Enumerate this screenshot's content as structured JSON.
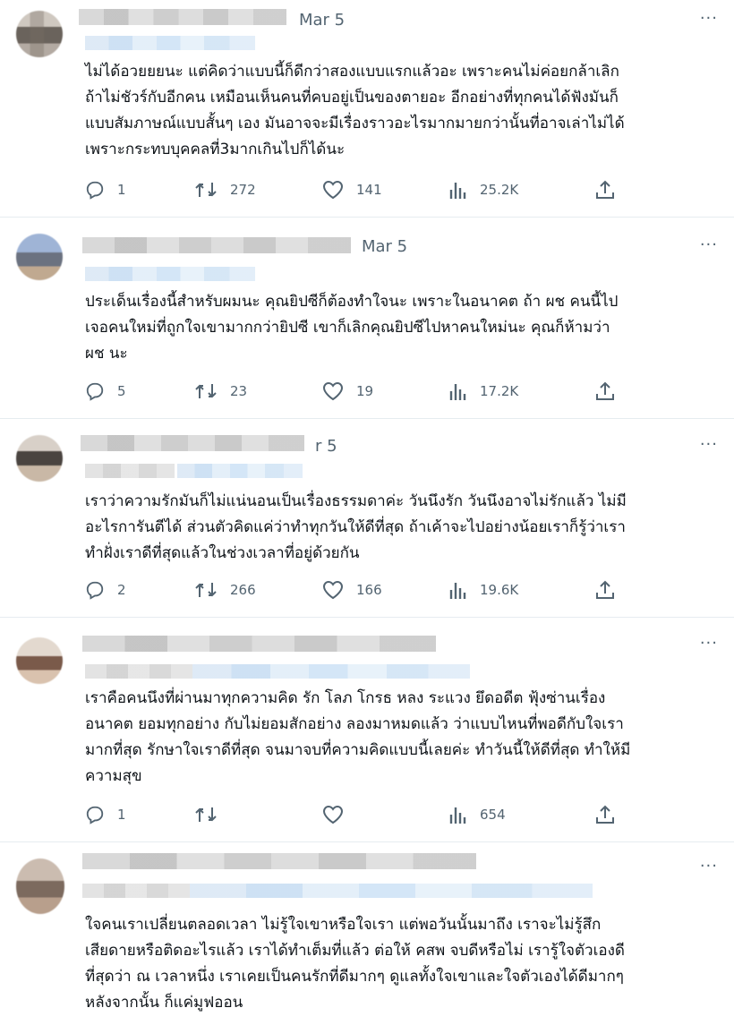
{
  "icons": {
    "reply": "reply-icon",
    "retweet": "retweet-icon",
    "like": "heart-icon",
    "views": "views-icon",
    "share": "share-icon",
    "more": "more-icon"
  },
  "colors": {
    "text": "#0f1419",
    "secondary": "#536471",
    "divider": "#e6ecf0"
  },
  "tweets": [
    {
      "date": "Mar 5",
      "lines": [
        "ไม่ได้อวยยยนะ แต่คิดว่าแบบนี้ก็ดีกว่าสองแบบแรกแล้วอะ เพราะคนไม่ค่อยกล้าเลิก",
        "ถ้าไม่ชัวร์กับอีกคน เหมือนเห็นคนที่คบอยู่เป็นของตายอะ อีกอย่างที่ทุกคนได้ฟังมันก็",
        "แบบสัมภาษณ์แบบสั้นๆ เอง มันอาจจะมีเรื่องราวอะไรมากมายกว่านั้นที่อาจเล่าไม่ได้",
        "เพราะกระทบบุคคลที่3มากเกินไปก็ได้นะ"
      ],
      "replies": "1",
      "retweets": "272",
      "likes": "141",
      "views": "25.2K"
    },
    {
      "date": "Mar 5",
      "lines": [
        "ประเด็นเรื่องนี้สำหรับผมนะ คุณยิปซีก็ต้องทำใจนะ เพราะในอนาคต ถ้า ผช คนนี้ไป",
        "เจอคนใหม่ที่ถูกใจเขามากกว่ายิปซี เขาก็เลิกคุณยิปซีไปหาคนใหม่นะ    คุณก็ห้ามว่า",
        "ผช นะ"
      ],
      "replies": "5",
      "retweets": "23",
      "likes": "19",
      "views": "17.2K"
    },
    {
      "date": "r 5",
      "lines": [
        "เราว่าความรักมันก็ไม่แน่นอนเป็นเรื่องธรรมดาค่ะ วันนึงรัก วันนึงอาจไม่รักแล้ว ไม่มี",
        "อะไรการันตีได้ ส่วนตัวคิดแค่ว่าทำทุกวันให้ดีที่สุด ถ้าเค้าจะไปอย่างน้อยเราก็รู้ว่าเรา",
        "ทำฝั่งเราดีที่สุดแล้วในช่วงเวลาที่อยู่ด้วยกัน"
      ],
      "replies": "2",
      "retweets": "266",
      "likes": "166",
      "views": "19.6K"
    },
    {
      "date": "",
      "lines": [
        "เราคือคนนึงที่ผ่านมาทุกความคิด รัก โลภ โกรธ หลง ระแวง ยึดอดีต ฟุ้งซ่านเรื่อง",
        "อนาคต ยอมทุกอย่าง กับไม่ยอมสักอย่าง ลองมาหมดแล้ว ว่าแบบไหนที่พอดีกับใจเรา",
        "มากที่สุด รักษาใจเราดีที่สุด จนมาจบที่ความคิดแบบนี้เลยค่ะ ทำวันนี้ให้ดีที่สุด ทำให้มี",
        "ความสุข"
      ],
      "replies": "1",
      "retweets": "",
      "likes": "",
      "views": "654"
    },
    {
      "date": "",
      "lines": [
        "ใจคนเราเปลี่ยนตลอดเวลา ไม่รู้ใจเขาหรือใจเรา แต่พอวันนั้นมาถึง เราจะไม่รู้สึก",
        "เสียดายหรือติดอะไรแล้ว เราได้ทำเต็มที่แล้ว ต่อให้ คสพ จบดีหรือไม่ เรารู้ใจตัวเองดี",
        "ที่สุดว่า ณ เวลาหนึ่ง เราเคยเป็นคนรักที่ดีมากๆ ดูแลทั้งใจเขาและใจตัวเองได้ดีมากๆ",
        "หลังจากนั้น ก็แค่มูฟออน"
      ]
    }
  ]
}
